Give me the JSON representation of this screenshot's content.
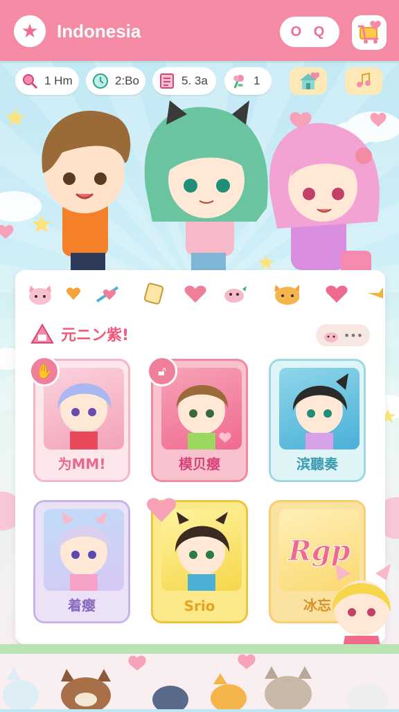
{
  "header": {
    "title": "Indonesia",
    "search_label": "O Q"
  },
  "stats": [
    {
      "icon": "magnifier-icon",
      "text": "1 Hm"
    },
    {
      "icon": "clock-icon",
      "text": "2:Bo"
    },
    {
      "icon": "notebook-icon",
      "text": "5. 3a"
    },
    {
      "icon": "flower-icon",
      "text": "1"
    }
  ],
  "section": {
    "title": "元ニン紫!"
  },
  "cards": [
    {
      "label": "为MM!",
      "badge": "hand-icon"
    },
    {
      "label": "模贝瘿",
      "badge": "lock-icon"
    },
    {
      "label": "滨聽奏",
      "badge": ""
    },
    {
      "label": "着瘿",
      "badge": ""
    },
    {
      "label": "Srio",
      "badge": ""
    },
    {
      "label": "冰忘",
      "badge": "",
      "art_text": "Rgp"
    }
  ],
  "colors": {
    "accent": "#f48aa4",
    "panel": "#ffffff"
  }
}
